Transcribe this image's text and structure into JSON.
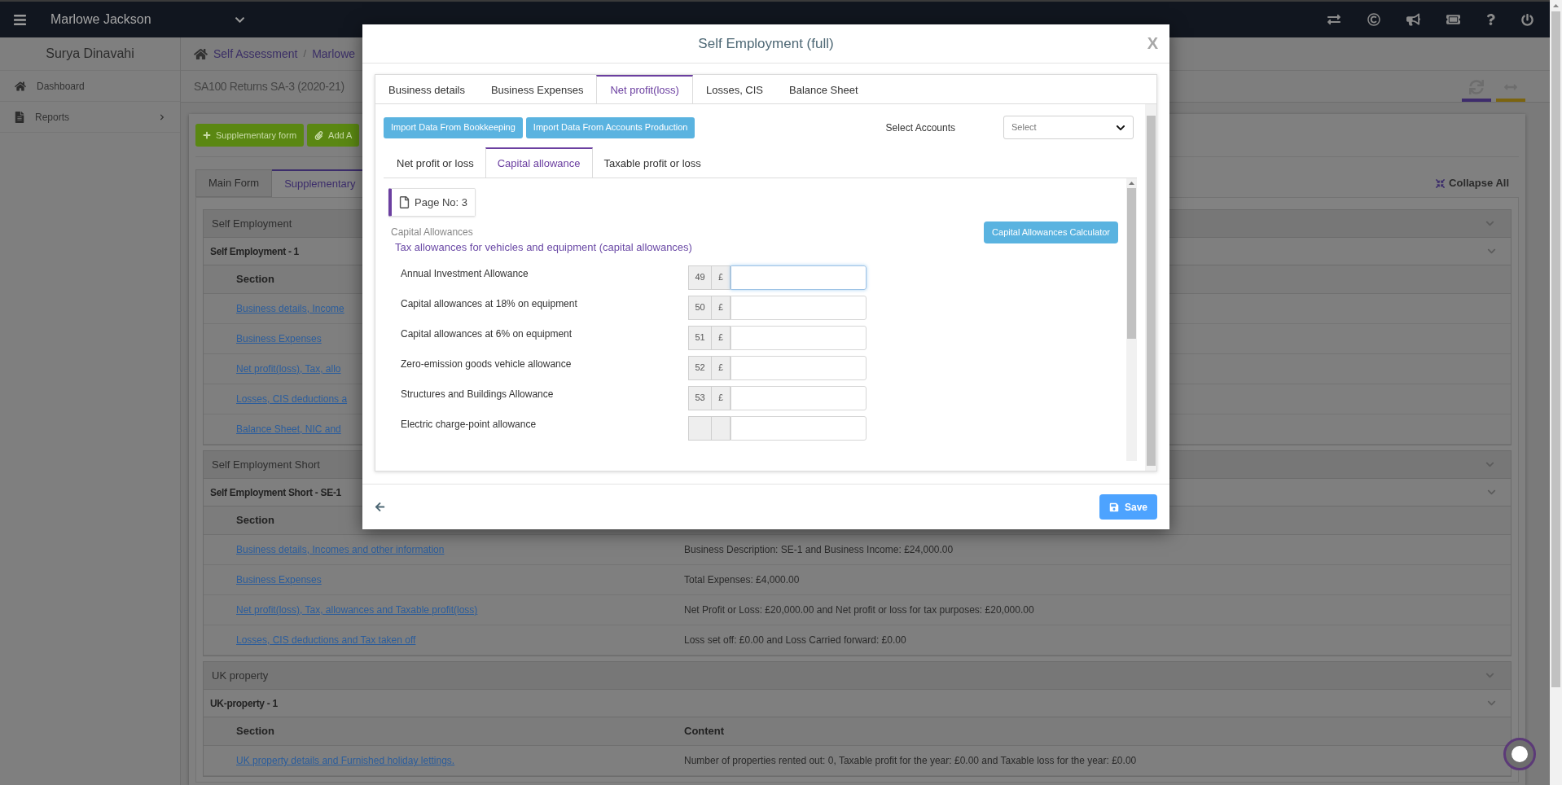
{
  "topbar": {
    "user": "Marlowe Jackson"
  },
  "sidebar": {
    "title": "Surya Dinavahi",
    "items": [
      {
        "kind": "home",
        "label": "Dashboard",
        "expandable": false
      },
      {
        "kind": "file",
        "label": "Reports",
        "expandable": true
      }
    ]
  },
  "breadcrumb": {
    "items": [
      "Self Assessment",
      "Marlowe"
    ],
    "separator": "/"
  },
  "page_title": "SA100 Returns SA-3 (2020-21)",
  "page_tools": [
    {
      "kind": "refresh",
      "color": "#3e2c6c"
    },
    {
      "kind": "expand",
      "color": "#7b6410"
    }
  ],
  "toolbar_buttons": [
    {
      "kind": "plus",
      "label": "Supplementary form"
    },
    {
      "kind": "clip",
      "label": "Add A"
    }
  ],
  "form_tabs": [
    {
      "label": "Main Form",
      "selected": false
    },
    {
      "label": "Supplementary",
      "selected": true
    }
  ],
  "collapse_all": "Collapse All",
  "sections": [
    {
      "title": "Self Employment",
      "entry_title": "Self Employment - 1",
      "columns": [
        "Section"
      ],
      "rows": [
        {
          "section": "Business details, Income"
        },
        {
          "section": "Business Expenses"
        },
        {
          "section": "Net profit(loss), Tax, allo"
        },
        {
          "section": "Losses, CIS deductions a"
        },
        {
          "section": "Balance Sheet, NIC and"
        }
      ]
    },
    {
      "title": "Self Employment Short",
      "entry_title": "Self Employment Short - SE-1",
      "columns": [
        "Section"
      ],
      "rows": [
        {
          "section": "Business details, Incomes and other information",
          "content": "Business Description: SE-1 and Business Income: £24,000.00"
        },
        {
          "section": "Business Expenses",
          "content": "Total Expenses: £4,000.00"
        },
        {
          "section": "Net profit(loss), Tax, allowances and Taxable profit(loss)",
          "content": "Net Profit or Loss: £20,000.00 and Net profit or loss for tax purposes: £20,000.00"
        },
        {
          "section": "Losses, CIS deductions and Tax taken off",
          "content": "Loss set off: £0.00 and Loss Carried forward: £0.00"
        }
      ]
    },
    {
      "title": "UK property",
      "entry_title": "UK-property - 1",
      "columns": [
        "Section",
        "Content"
      ],
      "rows": [
        {
          "section": "UK property details and Furnished holiday lettings.",
          "content": "Number of properties rented out: 0, Taxable profit for the year: £0.00 and Taxable loss for the year: £0.00"
        }
      ]
    }
  ],
  "modal": {
    "title": "Self Employment (full)",
    "close": "X",
    "tabs": [
      {
        "label": "Business details",
        "selected": false
      },
      {
        "label": "Business Expenses",
        "selected": false
      },
      {
        "label": "Net profit(loss)",
        "selected": true
      },
      {
        "label": "Losses, CIS",
        "selected": false
      },
      {
        "label": "Balance Sheet",
        "selected": false
      }
    ],
    "import_buttons": [
      "Import Data From Bookkeeping",
      "Import Data From Accounts Production"
    ],
    "select_accounts": {
      "label": "Select Accounts",
      "placeholder": "Select"
    },
    "sub_tabs": [
      {
        "label": "Net profit or loss",
        "selected": false
      },
      {
        "label": "Capital allowance",
        "selected": true
      },
      {
        "label": "Taxable profit or loss",
        "selected": false
      }
    ],
    "page_no": "Page No: 3",
    "group_label": "Capital Allowances",
    "heading": "Tax allowances for vehicles and equipment (capital allowances)",
    "calculator_button": "Capital Allowances Calculator",
    "fields": [
      {
        "label": "Annual Investment Allowance",
        "number": "49",
        "currency": "£",
        "focused": true
      },
      {
        "label": "Capital allowances at 18% on equipment",
        "number": "50",
        "currency": "£",
        "focused": false
      },
      {
        "label": "Capital allowances at 6% on equipment",
        "number": "51",
        "currency": "£",
        "focused": false
      },
      {
        "label": "Zero-emission goods vehicle allowance",
        "number": "52",
        "currency": "£",
        "focused": false
      },
      {
        "label": "Structures and Buildings Allowance",
        "number": "53",
        "currency": "£",
        "focused": false
      },
      {
        "label": "Electric charge-point allowance",
        "focused": false
      }
    ],
    "save_button": "Save"
  }
}
